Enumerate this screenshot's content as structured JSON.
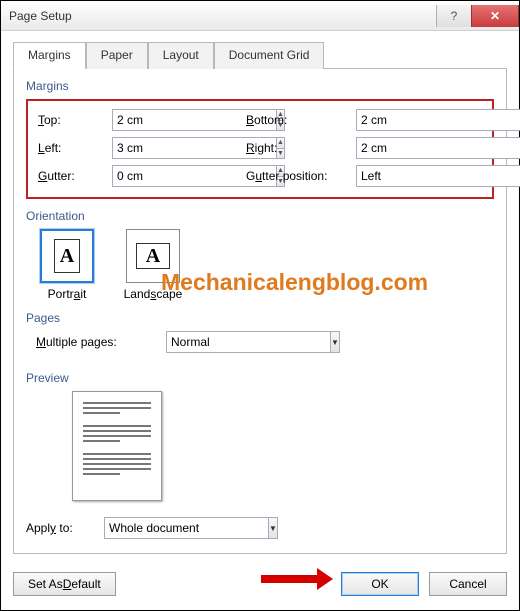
{
  "titlebar": {
    "title": "Page Setup",
    "help": "?",
    "close": "✕"
  },
  "tabs": {
    "margins": "Margins",
    "paper": "Paper",
    "layout": "Layout",
    "grid": "Document Grid"
  },
  "margins_group_label": "Margins",
  "margins": {
    "top_label": "Top:",
    "top_value": "2 cm",
    "bottom_label": "Bottom:",
    "bottom_value": "2 cm",
    "left_label": "Left:",
    "left_value": "3 cm",
    "right_label": "Right:",
    "right_value": "2 cm",
    "gutter_label": "Gutter:",
    "gutter_value": "0 cm",
    "gutter_pos_label": "Gutter position:",
    "gutter_pos_value": "Left"
  },
  "orientation": {
    "group_label": "Orientation",
    "portrait_label": "Portrait",
    "landscape_label": "Landscape",
    "glyph": "A"
  },
  "pages": {
    "group_label": "Pages",
    "multiple_label": "Multiple pages:",
    "multiple_value": "Normal"
  },
  "preview": {
    "group_label": "Preview"
  },
  "apply": {
    "label": "Apply to:",
    "value": "Whole document"
  },
  "buttons": {
    "default": "Set As Default",
    "ok": "OK",
    "cancel": "Cancel"
  },
  "watermark": "Mechanicalengblog.com",
  "spin_up": "▲",
  "spin_down": "▼",
  "combo_arrow": "▼"
}
